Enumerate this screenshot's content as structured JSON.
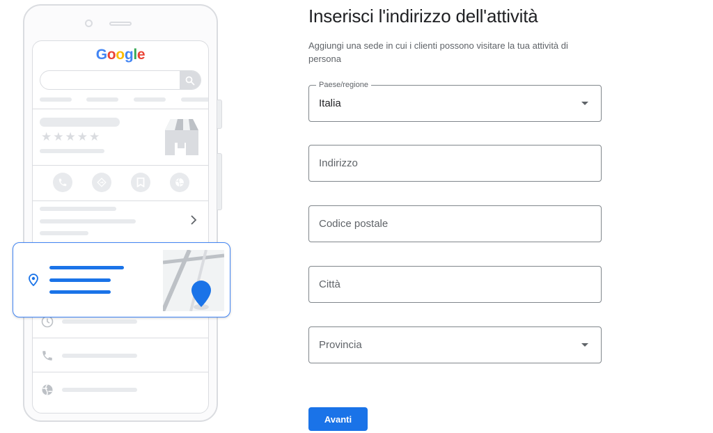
{
  "illustration": {
    "brand": {
      "letters": [
        "G",
        "o",
        "o",
        "g",
        "l",
        "e"
      ],
      "colors": [
        "#4285f4",
        "#ea4335",
        "#fbbc05",
        "#4285f4",
        "#34a853",
        "#ea4335"
      ]
    },
    "rating_stars": "★★★★★",
    "icons": [
      "phone-icon",
      "directions-icon",
      "bookmark-icon",
      "globe-icon",
      "clock-icon",
      "location-pin-icon",
      "storefront-icon",
      "chevron-right-icon",
      "search-icon"
    ]
  },
  "form": {
    "title": "Inserisci l'indirizzo dell'attività",
    "subtitle": "Aggiungi una sede in cui i clienti possono visitare la tua attività di persona",
    "country": {
      "label": "Paese/regione",
      "value": "Italia"
    },
    "address": {
      "placeholder": "Indirizzo"
    },
    "postal_code": {
      "placeholder": "Codice postale"
    },
    "city": {
      "placeholder": "Città"
    },
    "province": {
      "placeholder": "Provincia"
    },
    "next_button": "Avanti"
  },
  "colors": {
    "accent": "#1a73e8",
    "border": "#80868b",
    "muted_text": "#5f6368",
    "illustration_grey": "#dadce0"
  }
}
